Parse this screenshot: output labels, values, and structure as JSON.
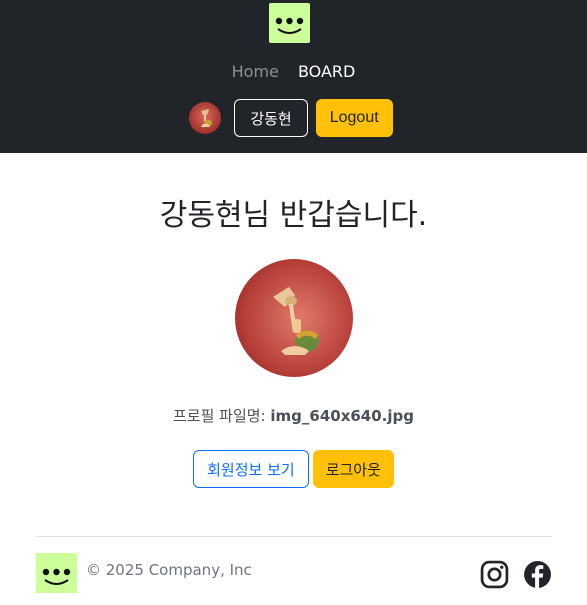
{
  "header": {
    "logo_icon": "smiley-logo-icon",
    "nav": {
      "home": "Home",
      "board": "BOARD"
    },
    "user": {
      "name": "강동현",
      "logout": "Logout"
    }
  },
  "main": {
    "welcome": "강동현님 반갑습니다.",
    "profile_label": "프로필 파일명: ",
    "profile_file": "img_640x640.jpg",
    "view_info": "회원정보 보기",
    "logout": "로그아웃"
  },
  "footer": {
    "copyright": "© 2025 Company, Inc",
    "social": [
      "instagram-icon",
      "facebook-icon"
    ]
  },
  "colors": {
    "header_bg": "#212529",
    "logo_bg": "#ccff99",
    "warning": "#ffc107",
    "primary": "#0d6efd"
  }
}
